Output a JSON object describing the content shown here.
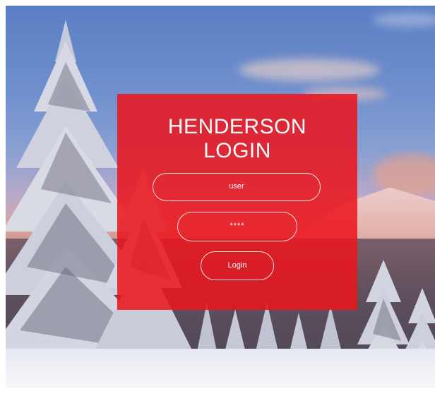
{
  "login": {
    "title_line1": "HENDERSON",
    "title_line2": "LOGIN",
    "username_value": "user",
    "password_value": "****",
    "login_button_label": "Login"
  },
  "colors": {
    "panel": "#eb141c",
    "text": "#ffffff"
  }
}
